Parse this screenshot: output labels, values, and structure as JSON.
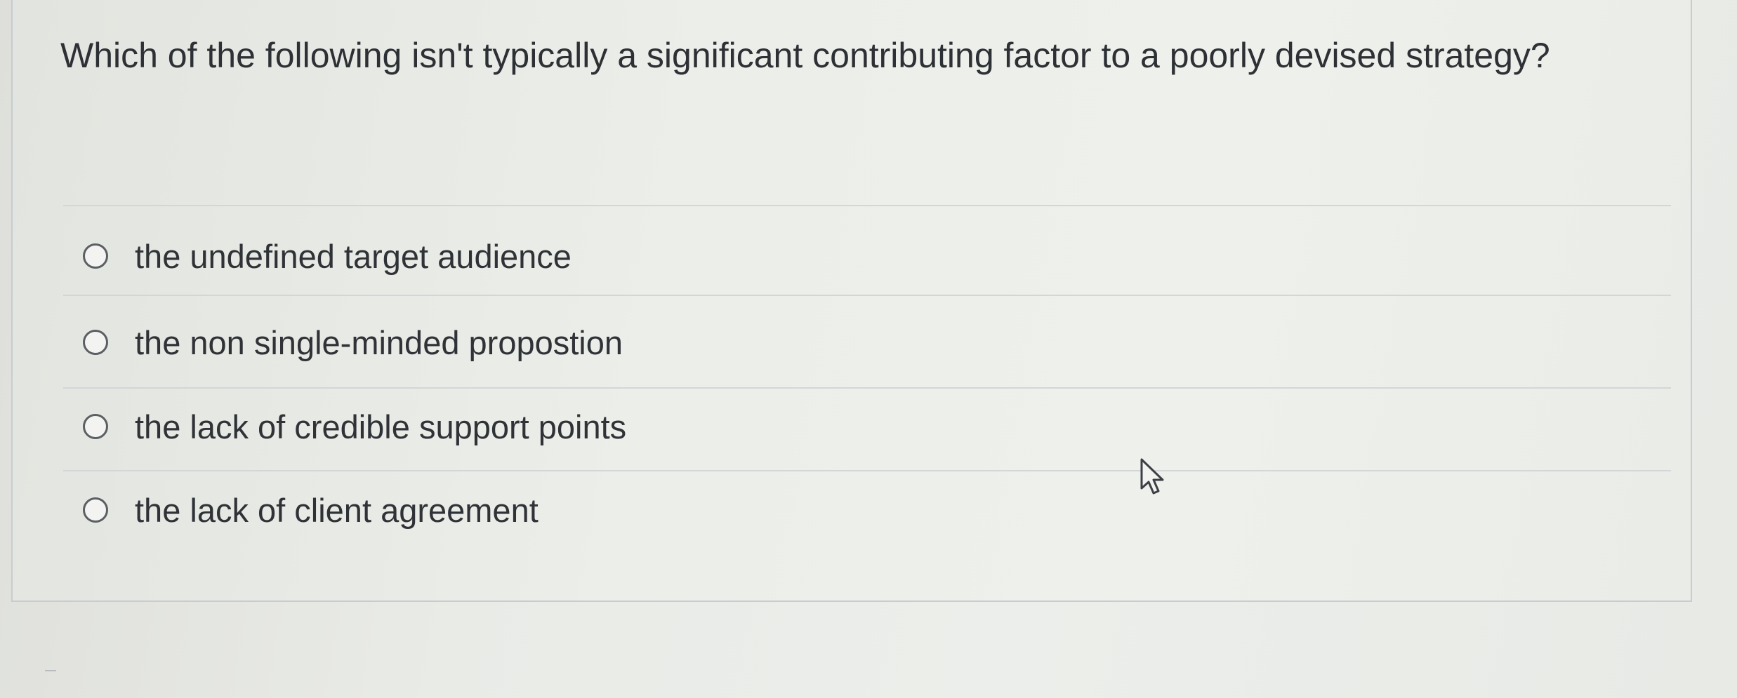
{
  "question": {
    "text": "Which of the following isn't typically a significant contributing factor to a poorly devised strategy?"
  },
  "answers": [
    {
      "label": "the undefined target audience",
      "selected": false
    },
    {
      "label": "the non single-minded propostion",
      "selected": false
    },
    {
      "label": "the lack of credible support points",
      "selected": false
    },
    {
      "label": "the lack of client agreement",
      "selected": false
    }
  ],
  "cursor": {
    "icon": "mouse-pointer-icon"
  }
}
